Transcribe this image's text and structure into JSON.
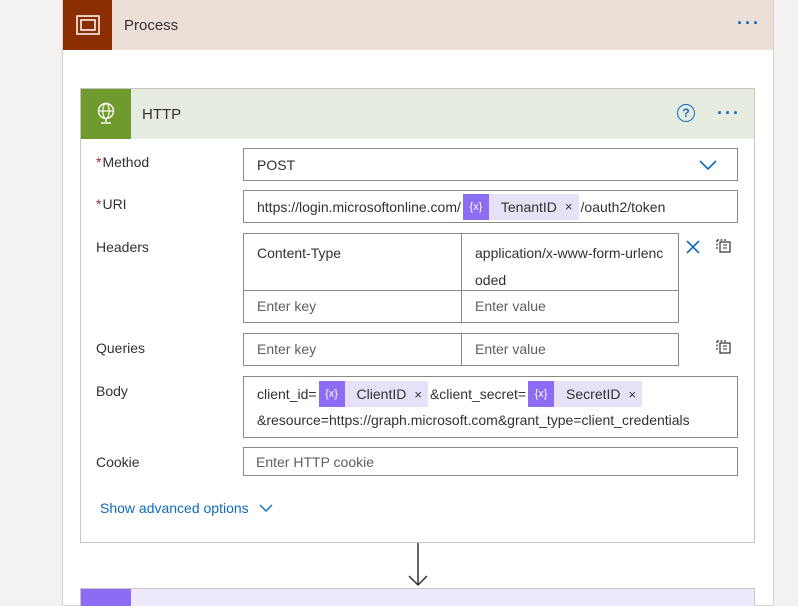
{
  "scope": {
    "title": "Process",
    "menu_icon": "more-dots-icon"
  },
  "http": {
    "title": "HTTP",
    "help_symbol": "?",
    "method": {
      "label": "Method",
      "value": "POST"
    },
    "uri": {
      "label": "URI",
      "prefix": "https://login.microsoftonline.com/",
      "token": "TenantID",
      "suffix": "/oauth2/token"
    },
    "headers": {
      "label": "Headers",
      "rows": [
        {
          "key": "Content-Type",
          "value": "application/x-www-form-urlencoded"
        }
      ],
      "key_placeholder": "Enter key",
      "value_placeholder": "Enter value"
    },
    "queries": {
      "label": "Queries",
      "key_placeholder": "Enter key",
      "value_placeholder": "Enter value"
    },
    "body": {
      "label": "Body",
      "part1": "client_id=",
      "token1": "ClientID",
      "part2": "&client_secret=",
      "token2": "SecretID",
      "line2": "&resource=https://graph.microsoft.com&grant_type=client_credentials"
    },
    "cookie": {
      "label": "Cookie",
      "placeholder": "Enter HTTP cookie"
    },
    "show_advanced": "Show advanced options"
  },
  "token_symbol": "{x}",
  "close_symbol": "×",
  "required_mark": "*",
  "colors": {
    "scope_accent": "#8a2d00",
    "http_accent": "#6f9b2e",
    "link": "#0f6cbd",
    "token_accent": "#8c6cf3"
  }
}
